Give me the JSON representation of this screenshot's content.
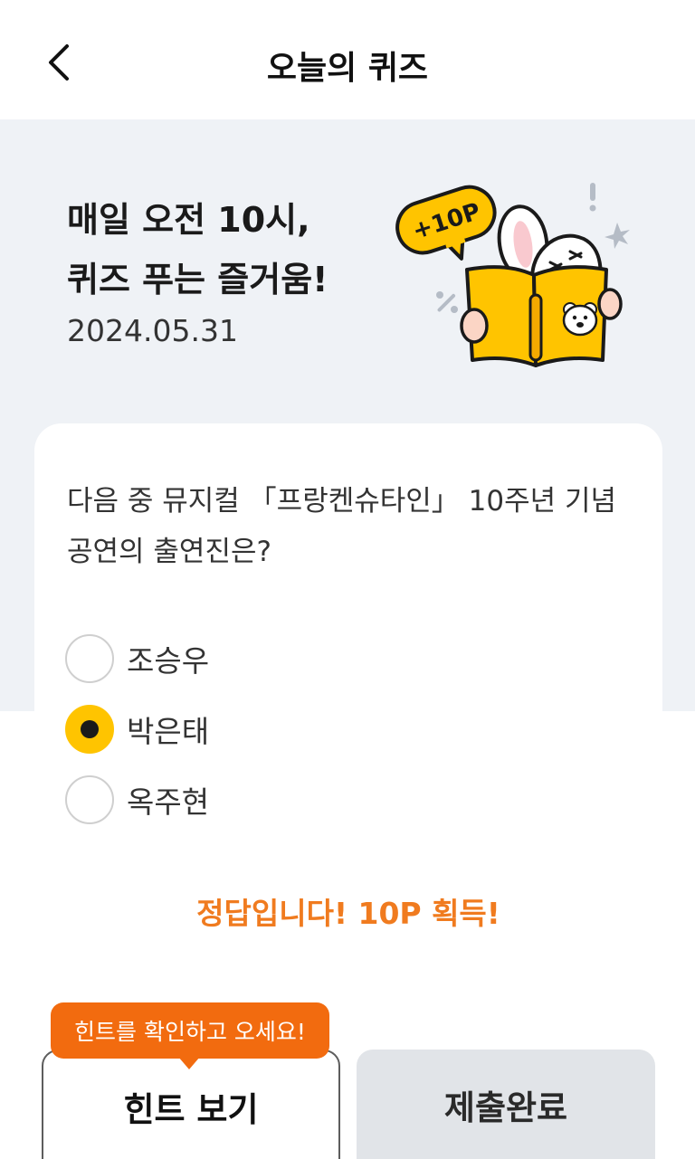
{
  "header": {
    "title": "오늘의 퀴즈"
  },
  "hero": {
    "line1": "매일 오전 10시,",
    "line2": "퀴즈 푸는 즐거움!",
    "date": "2024.05.31",
    "badge": "+10P"
  },
  "quiz": {
    "question": "다음 중 뮤지컬 「프랑켄슈타인」 10주년 기념공연의 출연진은?",
    "options": [
      {
        "label": "조승우",
        "selected": false
      },
      {
        "label": "박은태",
        "selected": true
      },
      {
        "label": "옥주현",
        "selected": false
      }
    ],
    "result": "정답입니다! 10P 획득!"
  },
  "actions": {
    "tooltip": "힌트를 확인하고 오세요!",
    "hint_label": "힌트 보기",
    "submit_label": "제출완료"
  },
  "colors": {
    "accent": "#ffc400",
    "result": "#f07b1f",
    "tooltip": "#f26b0f",
    "hero_bg": "#eff2f6"
  }
}
